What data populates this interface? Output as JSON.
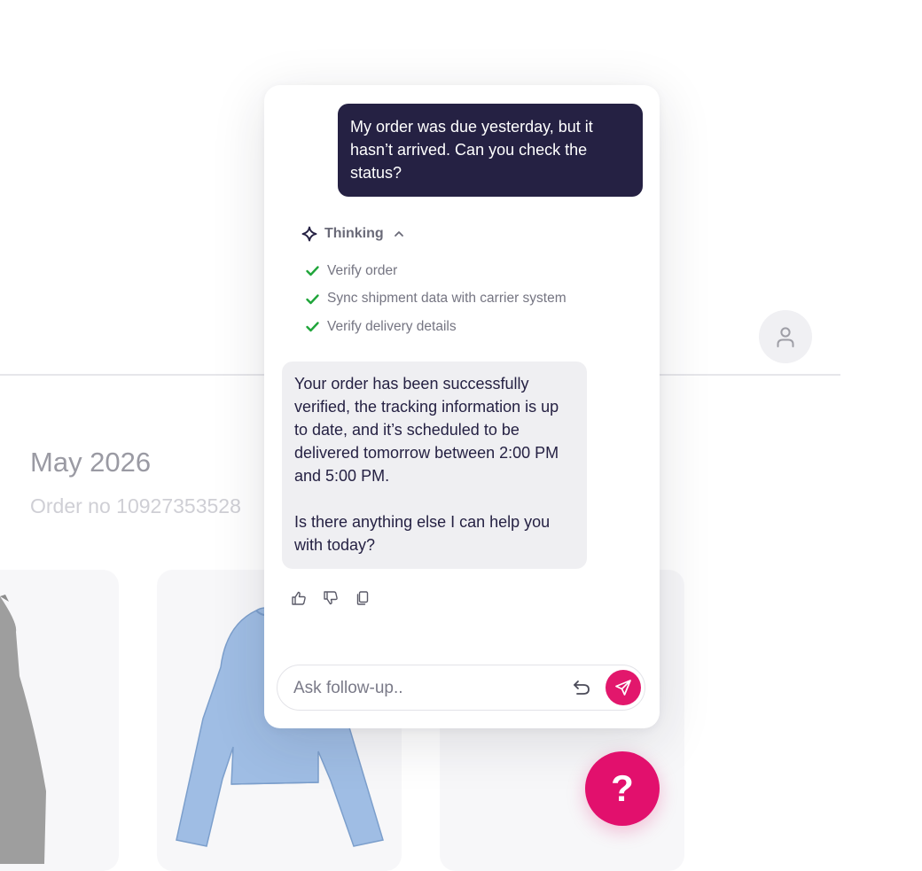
{
  "page": {
    "month_title": "May 2026",
    "order_no": "Order no 10927353528"
  },
  "products": [
    {
      "icon": "tank-top-icon",
      "color": "#9e9e9e"
    },
    {
      "icon": "sweater-icon",
      "color": "#9fbde4"
    },
    {
      "icon": "product-placeholder",
      "color": "#f7f7f9"
    }
  ],
  "chat": {
    "user_message": "My order was due yesterday, but it hasn’t arrived. Can you check the status?",
    "thinking": {
      "label": "Thinking",
      "icon": "sparkle-icon",
      "toggle_icon": "chevron-up-icon",
      "steps": [
        {
          "label": "Verify order",
          "status": "done"
        },
        {
          "label": "Sync shipment data with carrier system",
          "status": "done"
        },
        {
          "label": "Verify delivery details",
          "status": "done"
        }
      ]
    },
    "bot_message": {
      "paragraph_1": "Your order has been successfully verified, the tracking information is up to date, and it’s scheduled to be delivered tomorrow between 2:00 PM and 5:00 PM.",
      "paragraph_2": "Is there anything else I can help you with today?"
    },
    "feedback": [
      "thumbs-up-icon",
      "thumbs-down-icon",
      "copy-icon"
    ],
    "input": {
      "placeholder": "Ask follow-up..",
      "value": "",
      "undo_icon": "undo-icon",
      "send_icon": "send-icon"
    }
  },
  "help_button": {
    "label": "?"
  },
  "colors": {
    "accent": "#e2176c",
    "user_bubble": "#252143",
    "bot_bubble": "#efeff2",
    "check": "#1fa53a"
  }
}
